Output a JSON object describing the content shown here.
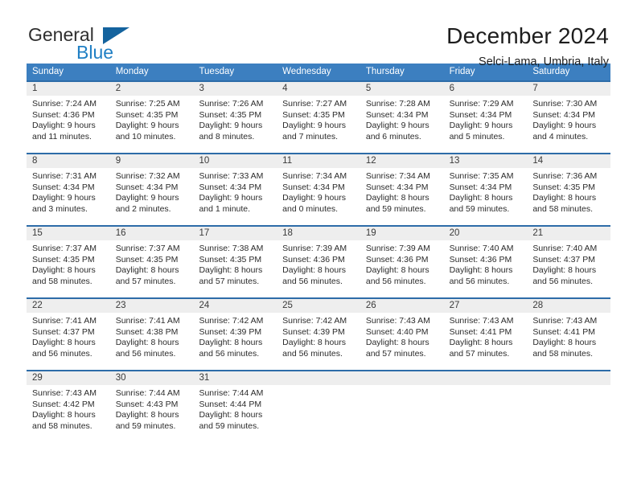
{
  "brand": {
    "word_one": "General",
    "word_two": "Blue",
    "mark": "triangle-logo"
  },
  "header": {
    "title": "December 2024",
    "location": "Selci-Lama, Umbria, Italy"
  },
  "colors": {
    "header_blue": "#3c7fc0",
    "cell_border_blue": "#2d6ca8",
    "daynum_bg": "#eeeeee",
    "brand_blue": "#1f7fc4",
    "brand_mark": "#14639e"
  },
  "calendar": {
    "weekday_headers": [
      "Sunday",
      "Monday",
      "Tuesday",
      "Wednesday",
      "Thursday",
      "Friday",
      "Saturday"
    ],
    "weeks": [
      [
        {
          "day": "1",
          "sunrise": "Sunrise: 7:24 AM",
          "sunset": "Sunset: 4:36 PM",
          "daylight_1": "Daylight: 9 hours",
          "daylight_2": "and 11 minutes."
        },
        {
          "day": "2",
          "sunrise": "Sunrise: 7:25 AM",
          "sunset": "Sunset: 4:35 PM",
          "daylight_1": "Daylight: 9 hours",
          "daylight_2": "and 10 minutes."
        },
        {
          "day": "3",
          "sunrise": "Sunrise: 7:26 AM",
          "sunset": "Sunset: 4:35 PM",
          "daylight_1": "Daylight: 9 hours",
          "daylight_2": "and 8 minutes."
        },
        {
          "day": "4",
          "sunrise": "Sunrise: 7:27 AM",
          "sunset": "Sunset: 4:35 PM",
          "daylight_1": "Daylight: 9 hours",
          "daylight_2": "and 7 minutes."
        },
        {
          "day": "5",
          "sunrise": "Sunrise: 7:28 AM",
          "sunset": "Sunset: 4:34 PM",
          "daylight_1": "Daylight: 9 hours",
          "daylight_2": "and 6 minutes."
        },
        {
          "day": "6",
          "sunrise": "Sunrise: 7:29 AM",
          "sunset": "Sunset: 4:34 PM",
          "daylight_1": "Daylight: 9 hours",
          "daylight_2": "and 5 minutes."
        },
        {
          "day": "7",
          "sunrise": "Sunrise: 7:30 AM",
          "sunset": "Sunset: 4:34 PM",
          "daylight_1": "Daylight: 9 hours",
          "daylight_2": "and 4 minutes."
        }
      ],
      [
        {
          "day": "8",
          "sunrise": "Sunrise: 7:31 AM",
          "sunset": "Sunset: 4:34 PM",
          "daylight_1": "Daylight: 9 hours",
          "daylight_2": "and 3 minutes."
        },
        {
          "day": "9",
          "sunrise": "Sunrise: 7:32 AM",
          "sunset": "Sunset: 4:34 PM",
          "daylight_1": "Daylight: 9 hours",
          "daylight_2": "and 2 minutes."
        },
        {
          "day": "10",
          "sunrise": "Sunrise: 7:33 AM",
          "sunset": "Sunset: 4:34 PM",
          "daylight_1": "Daylight: 9 hours",
          "daylight_2": "and 1 minute."
        },
        {
          "day": "11",
          "sunrise": "Sunrise: 7:34 AM",
          "sunset": "Sunset: 4:34 PM",
          "daylight_1": "Daylight: 9 hours",
          "daylight_2": "and 0 minutes."
        },
        {
          "day": "12",
          "sunrise": "Sunrise: 7:34 AM",
          "sunset": "Sunset: 4:34 PM",
          "daylight_1": "Daylight: 8 hours",
          "daylight_2": "and 59 minutes."
        },
        {
          "day": "13",
          "sunrise": "Sunrise: 7:35 AM",
          "sunset": "Sunset: 4:34 PM",
          "daylight_1": "Daylight: 8 hours",
          "daylight_2": "and 59 minutes."
        },
        {
          "day": "14",
          "sunrise": "Sunrise: 7:36 AM",
          "sunset": "Sunset: 4:35 PM",
          "daylight_1": "Daylight: 8 hours",
          "daylight_2": "and 58 minutes."
        }
      ],
      [
        {
          "day": "15",
          "sunrise": "Sunrise: 7:37 AM",
          "sunset": "Sunset: 4:35 PM",
          "daylight_1": "Daylight: 8 hours",
          "daylight_2": "and 58 minutes."
        },
        {
          "day": "16",
          "sunrise": "Sunrise: 7:37 AM",
          "sunset": "Sunset: 4:35 PM",
          "daylight_1": "Daylight: 8 hours",
          "daylight_2": "and 57 minutes."
        },
        {
          "day": "17",
          "sunrise": "Sunrise: 7:38 AM",
          "sunset": "Sunset: 4:35 PM",
          "daylight_1": "Daylight: 8 hours",
          "daylight_2": "and 57 minutes."
        },
        {
          "day": "18",
          "sunrise": "Sunrise: 7:39 AM",
          "sunset": "Sunset: 4:36 PM",
          "daylight_1": "Daylight: 8 hours",
          "daylight_2": "and 56 minutes."
        },
        {
          "day": "19",
          "sunrise": "Sunrise: 7:39 AM",
          "sunset": "Sunset: 4:36 PM",
          "daylight_1": "Daylight: 8 hours",
          "daylight_2": "and 56 minutes."
        },
        {
          "day": "20",
          "sunrise": "Sunrise: 7:40 AM",
          "sunset": "Sunset: 4:36 PM",
          "daylight_1": "Daylight: 8 hours",
          "daylight_2": "and 56 minutes."
        },
        {
          "day": "21",
          "sunrise": "Sunrise: 7:40 AM",
          "sunset": "Sunset: 4:37 PM",
          "daylight_1": "Daylight: 8 hours",
          "daylight_2": "and 56 minutes."
        }
      ],
      [
        {
          "day": "22",
          "sunrise": "Sunrise: 7:41 AM",
          "sunset": "Sunset: 4:37 PM",
          "daylight_1": "Daylight: 8 hours",
          "daylight_2": "and 56 minutes."
        },
        {
          "day": "23",
          "sunrise": "Sunrise: 7:41 AM",
          "sunset": "Sunset: 4:38 PM",
          "daylight_1": "Daylight: 8 hours",
          "daylight_2": "and 56 minutes."
        },
        {
          "day": "24",
          "sunrise": "Sunrise: 7:42 AM",
          "sunset": "Sunset: 4:39 PM",
          "daylight_1": "Daylight: 8 hours",
          "daylight_2": "and 56 minutes."
        },
        {
          "day": "25",
          "sunrise": "Sunrise: 7:42 AM",
          "sunset": "Sunset: 4:39 PM",
          "daylight_1": "Daylight: 8 hours",
          "daylight_2": "and 56 minutes."
        },
        {
          "day": "26",
          "sunrise": "Sunrise: 7:43 AM",
          "sunset": "Sunset: 4:40 PM",
          "daylight_1": "Daylight: 8 hours",
          "daylight_2": "and 57 minutes."
        },
        {
          "day": "27",
          "sunrise": "Sunrise: 7:43 AM",
          "sunset": "Sunset: 4:41 PM",
          "daylight_1": "Daylight: 8 hours",
          "daylight_2": "and 57 minutes."
        },
        {
          "day": "28",
          "sunrise": "Sunrise: 7:43 AM",
          "sunset": "Sunset: 4:41 PM",
          "daylight_1": "Daylight: 8 hours",
          "daylight_2": "and 58 minutes."
        }
      ],
      [
        {
          "day": "29",
          "sunrise": "Sunrise: 7:43 AM",
          "sunset": "Sunset: 4:42 PM",
          "daylight_1": "Daylight: 8 hours",
          "daylight_2": "and 58 minutes."
        },
        {
          "day": "30",
          "sunrise": "Sunrise: 7:44 AM",
          "sunset": "Sunset: 4:43 PM",
          "daylight_1": "Daylight: 8 hours",
          "daylight_2": "and 59 minutes."
        },
        {
          "day": "31",
          "sunrise": "Sunrise: 7:44 AM",
          "sunset": "Sunset: 4:44 PM",
          "daylight_1": "Daylight: 8 hours",
          "daylight_2": "and 59 minutes."
        },
        {
          "day": "",
          "sunrise": "",
          "sunset": "",
          "daylight_1": "",
          "daylight_2": ""
        },
        {
          "day": "",
          "sunrise": "",
          "sunset": "",
          "daylight_1": "",
          "daylight_2": ""
        },
        {
          "day": "",
          "sunrise": "",
          "sunset": "",
          "daylight_1": "",
          "daylight_2": ""
        },
        {
          "day": "",
          "sunrise": "",
          "sunset": "",
          "daylight_1": "",
          "daylight_2": ""
        }
      ]
    ]
  }
}
